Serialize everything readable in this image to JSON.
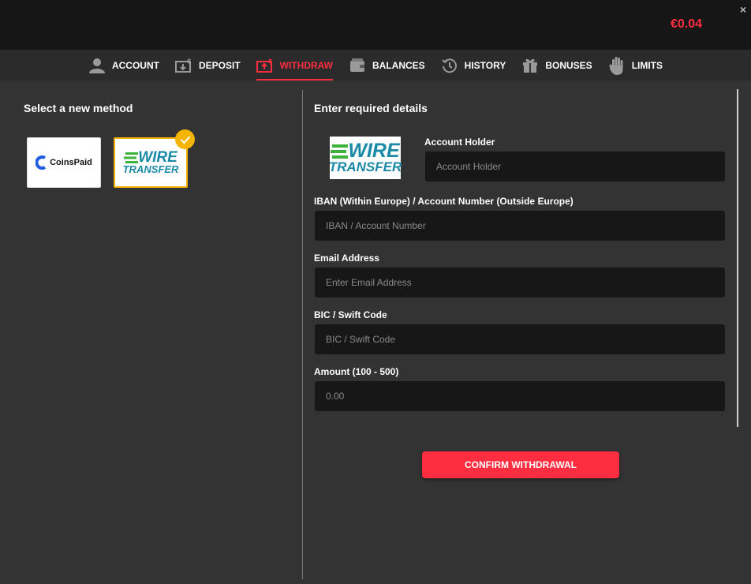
{
  "header": {
    "balance": "€0.04",
    "close_symbol": "×"
  },
  "nav": {
    "items": [
      {
        "label": "ACCOUNT",
        "icon": "user-icon",
        "active": false
      },
      {
        "label": "DEPOSIT",
        "icon": "deposit-icon",
        "active": false
      },
      {
        "label": "WITHDRAW",
        "icon": "withdraw-icon",
        "active": true
      },
      {
        "label": "BALANCES",
        "icon": "wallet-icon",
        "active": false
      },
      {
        "label": "HISTORY",
        "icon": "history-icon",
        "active": false
      },
      {
        "label": "BONUSES",
        "icon": "gift-icon",
        "active": false
      },
      {
        "label": "LIMITS",
        "icon": "hand-icon",
        "active": false
      }
    ]
  },
  "methods": {
    "title": "Select a new method",
    "coinspaid": "CoinsPaid",
    "wire_line1": "WIRE",
    "wire_line2": "TRANSFER"
  },
  "details": {
    "title": "Enter required details",
    "account_holder_label": "Account Holder",
    "account_holder_placeholder": "Account Holder",
    "iban_label": "IBAN (Within Europe) / Account Number (Outside Europe)",
    "iban_placeholder": "IBAN / Account Number",
    "email_label": "Email Address",
    "email_placeholder": "Enter Email Address",
    "bic_label": "BIC / Swift Code",
    "bic_placeholder": "BIC / Swift Code",
    "amount_label": "Amount (100 - 500)",
    "amount_placeholder": "0.00",
    "confirm_label": "CONFIRM WITHDRAWAL"
  },
  "colors": {
    "accent": "#ff2d40",
    "selected_border": "#f5b400",
    "wire_green": "#3cb43c",
    "wire_teal": "#1a8aa6",
    "coinspaid_blue": "#1f5ce0"
  }
}
